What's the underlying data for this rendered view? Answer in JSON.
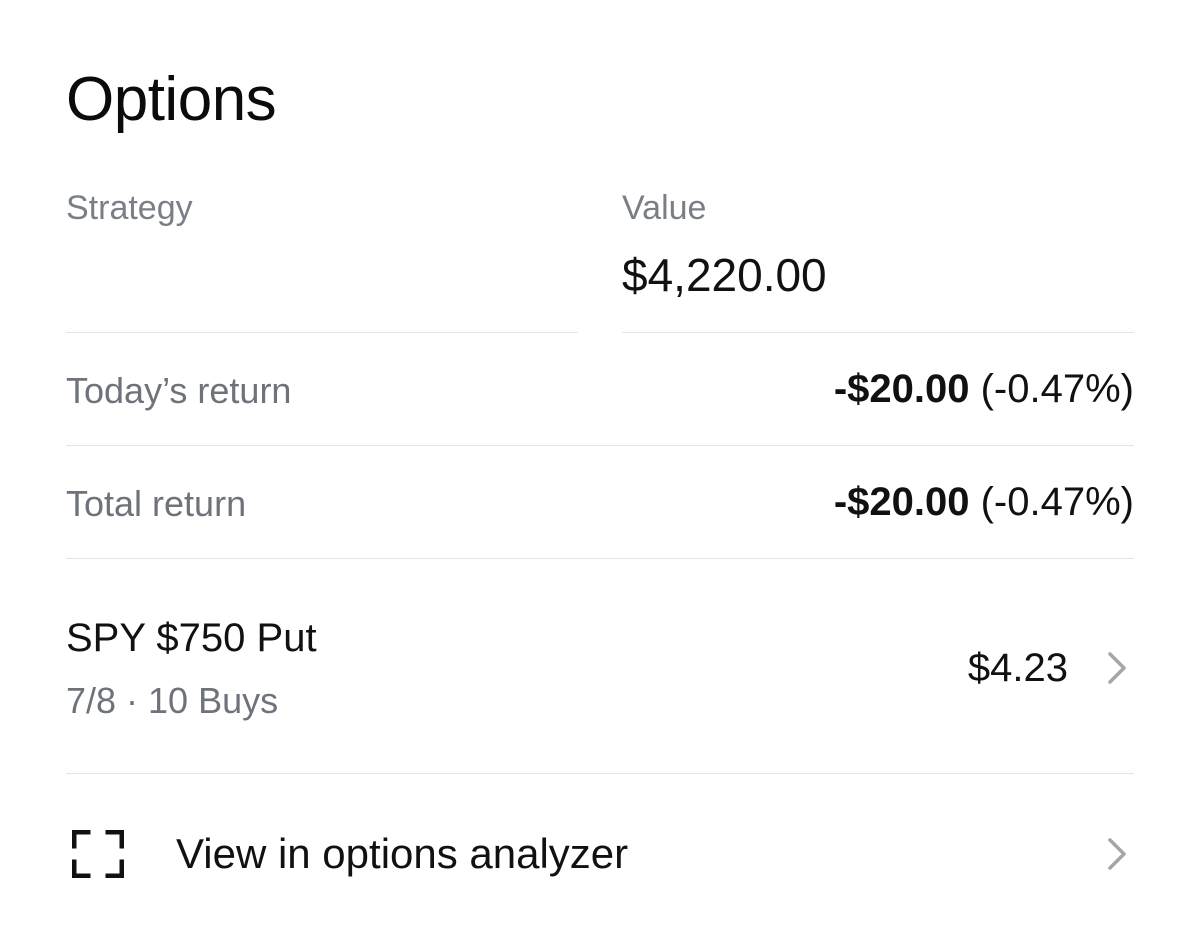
{
  "header": {
    "title": "Options"
  },
  "summary": {
    "strategy_label": "Strategy",
    "value_label": "Value",
    "value_amount": "$4,220.00"
  },
  "returns": [
    {
      "label": "Today’s return",
      "amount": "-$20.00",
      "percent": "(-0.47%)"
    },
    {
      "label": "Total return",
      "amount": "-$20.00",
      "percent": "(-0.47%)"
    }
  ],
  "position": {
    "name": "SPY $750 Put",
    "detail": "7/8 · 10 Buys",
    "price": "$4.23",
    "chevron_icon": "chevron-right-icon"
  },
  "analyzer": {
    "label": "View in options analyzer",
    "icon": "expand-corners-icon",
    "chevron_icon": "chevron-right-icon"
  },
  "colors": {
    "text_primary": "#111111",
    "text_muted": "#6e737b",
    "divider": "#e3e4e6",
    "chevron": "#a3a6ab"
  }
}
